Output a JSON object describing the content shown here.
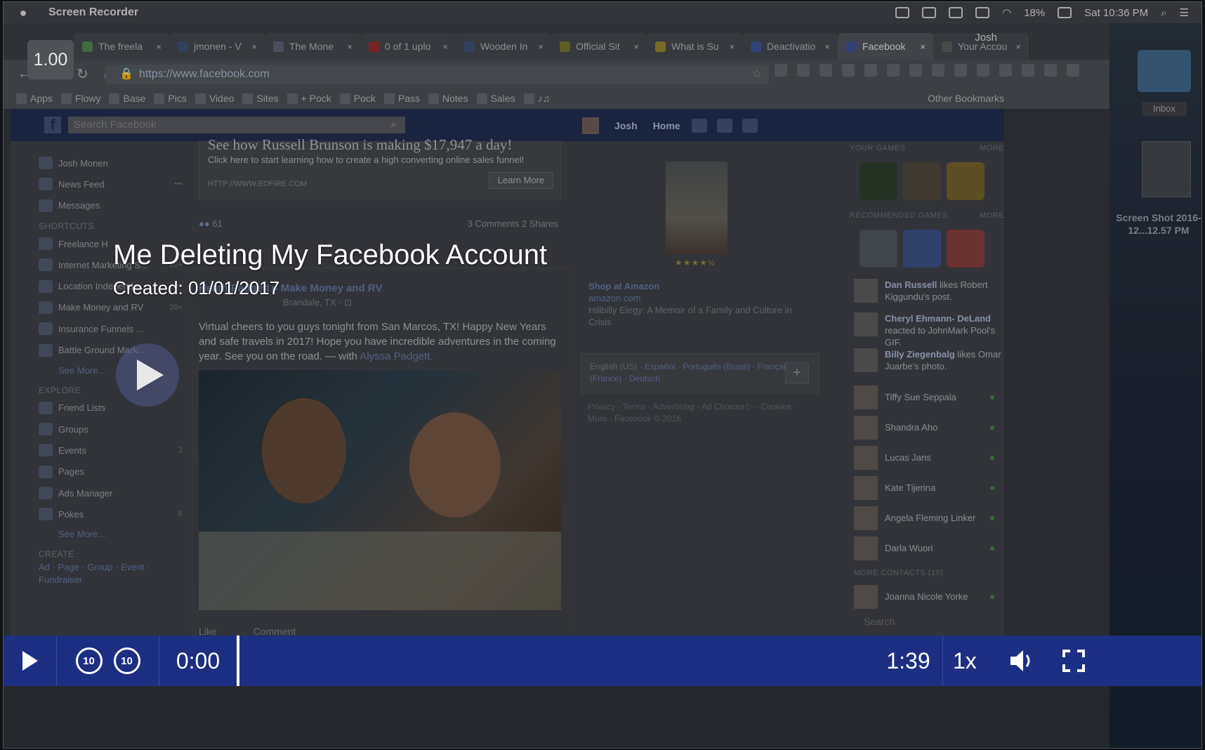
{
  "menubar": {
    "app": "Screen Recorder",
    "battery": "18%",
    "clock": "Sat 10:36 PM"
  },
  "player_speed_badge": "1.00",
  "browser": {
    "profile": "Josh",
    "tabs": [
      {
        "label": "The freela",
        "fav": "#4a7a4a"
      },
      {
        "label": "jmonen - V",
        "fav": "#3a4c6a"
      },
      {
        "label": "The Mone",
        "fav": "#555b6a"
      },
      {
        "label": "0 of 1 uplo",
        "fav": "#8a2a2a"
      },
      {
        "label": "Wooden In",
        "fav": "#3a4c6a"
      },
      {
        "label": "Official Sit",
        "fav": "#6a6a2a"
      },
      {
        "label": "What is Su",
        "fav": "#8a7a2a"
      },
      {
        "label": "Deactivatio",
        "fav": "#3a4c8a"
      },
      {
        "label": "Facebook",
        "fav": "#3a4c8a"
      },
      {
        "label": "Your Accou",
        "fav": "#555"
      }
    ],
    "url": "https://www.facebook.com",
    "bookmarks": [
      "Apps",
      "Flowy",
      "Base",
      "Pics",
      "Video",
      "Sites",
      "+ Pock",
      "Pock",
      "Pass",
      "Notes",
      "Sales",
      "♪♫"
    ],
    "other_bookmarks": "Other Bookmarks"
  },
  "facebook": {
    "search_placeholder": "Search Facebook",
    "user": "Josh",
    "home": "Home",
    "left": {
      "profile": "Josh Monen",
      "items": [
        {
          "label": "News Feed",
          "count": "•••"
        },
        {
          "label": "Messages",
          "count": ""
        }
      ],
      "shortcuts_head": "SHORTCUTS",
      "shortcuts": [
        {
          "label": "Freelance H",
          "count": ""
        },
        {
          "label": "Internet Marketing S...",
          "count": "20+"
        },
        {
          "label": "Location Independe...",
          "count": "20+"
        },
        {
          "label": "Make Money and RV",
          "count": "20+"
        },
        {
          "label": "Insurance Funnels ...",
          "count": ""
        },
        {
          "label": "Battle Ground Mark...",
          "count": ""
        }
      ],
      "see_more_1": "See More...",
      "explore_head": "EXPLORE",
      "explore": [
        {
          "label": "Friend Lists",
          "count": ""
        },
        {
          "label": "Groups",
          "count": ""
        },
        {
          "label": "Events",
          "count": "2"
        },
        {
          "label": "Pages",
          "count": ""
        },
        {
          "label": "Ads Manager",
          "count": ""
        },
        {
          "label": "Pokes",
          "count": "6"
        }
      ],
      "see_more_2": "See More...",
      "create_head": "CREATE",
      "create_links": "Ad · Page · Group · Event · Fundraiser"
    },
    "ad": {
      "title": "See how Russell Brunson is making $17,947 a day!",
      "sub": "Click here to start learning how to create a high converting online sales funnel!",
      "url": "HTTP://WWW.EOFIRE.COM",
      "cta": "Learn More"
    },
    "stats": {
      "reactions": "61",
      "comments": "3 Comments",
      "shares": "2 Shares"
    },
    "post": {
      "author": "Heath Padgett ▸ Make Money and RV",
      "location": "Brandale, TX · ⊡",
      "text": "Virtual cheers to you guys tonight from San Marcos, TX! Happy New Years and safe travels in 2017! Hope you have incredible adventures in the coming year. See you on the road. — with ",
      "tag": "Alyssa Padgett.",
      "like": "Like",
      "comment": "Comment"
    },
    "shop": {
      "title": "Shop at Amazon",
      "url": "amazon.com",
      "desc": "Hillbilly Elegy: A Memoir of a Family and Culture in Crisis",
      "stars": "★★★★½"
    },
    "languages": {
      "current": "English (US) · ",
      "others": "Español · Português (Brasil) · Français (France) · Deutsch"
    },
    "footer": "Privacy · Terms · Advertising · Ad Choices ▷ · Cookies · More · Facebook © 2016",
    "right": {
      "your_games": "YOUR GAMES",
      "recommended": "RECOMMENDED GAMES",
      "more": "MORE",
      "ticker": [
        {
          "name": "Dan Russell",
          "rest": " likes Robert Kiggundu's post."
        },
        {
          "name": "Cheryl Ehmann- DeLand",
          "rest": " reacted to JohnMark Pool's GIF."
        },
        {
          "name": "Billy Ziegenbalg",
          "rest": " likes Omar Juarbe's photo."
        }
      ],
      "contacts": [
        "Tiffy Sue Seppala",
        "Shandra Aho",
        "Lucas Jans",
        "Kate Tijerina",
        "Angela Fleming Linker",
        "Darla Wuori"
      ],
      "more_contacts": "MORE CONTACTS (15)",
      "extra_contact": "Joanna Nicole Yorke",
      "search": "Search"
    }
  },
  "desktop": {
    "folder_label": "Inbox",
    "screenshot_label": "Screen Shot 2016-12...12.57 PM"
  },
  "video": {
    "title": "Me Deleting My Facebook Account",
    "created": "Created: 01/01/2017",
    "current_time": "0:00",
    "duration": "1:39",
    "rate": "1x",
    "skip_back": "10",
    "skip_fwd": "10",
    "progress": 0
  }
}
